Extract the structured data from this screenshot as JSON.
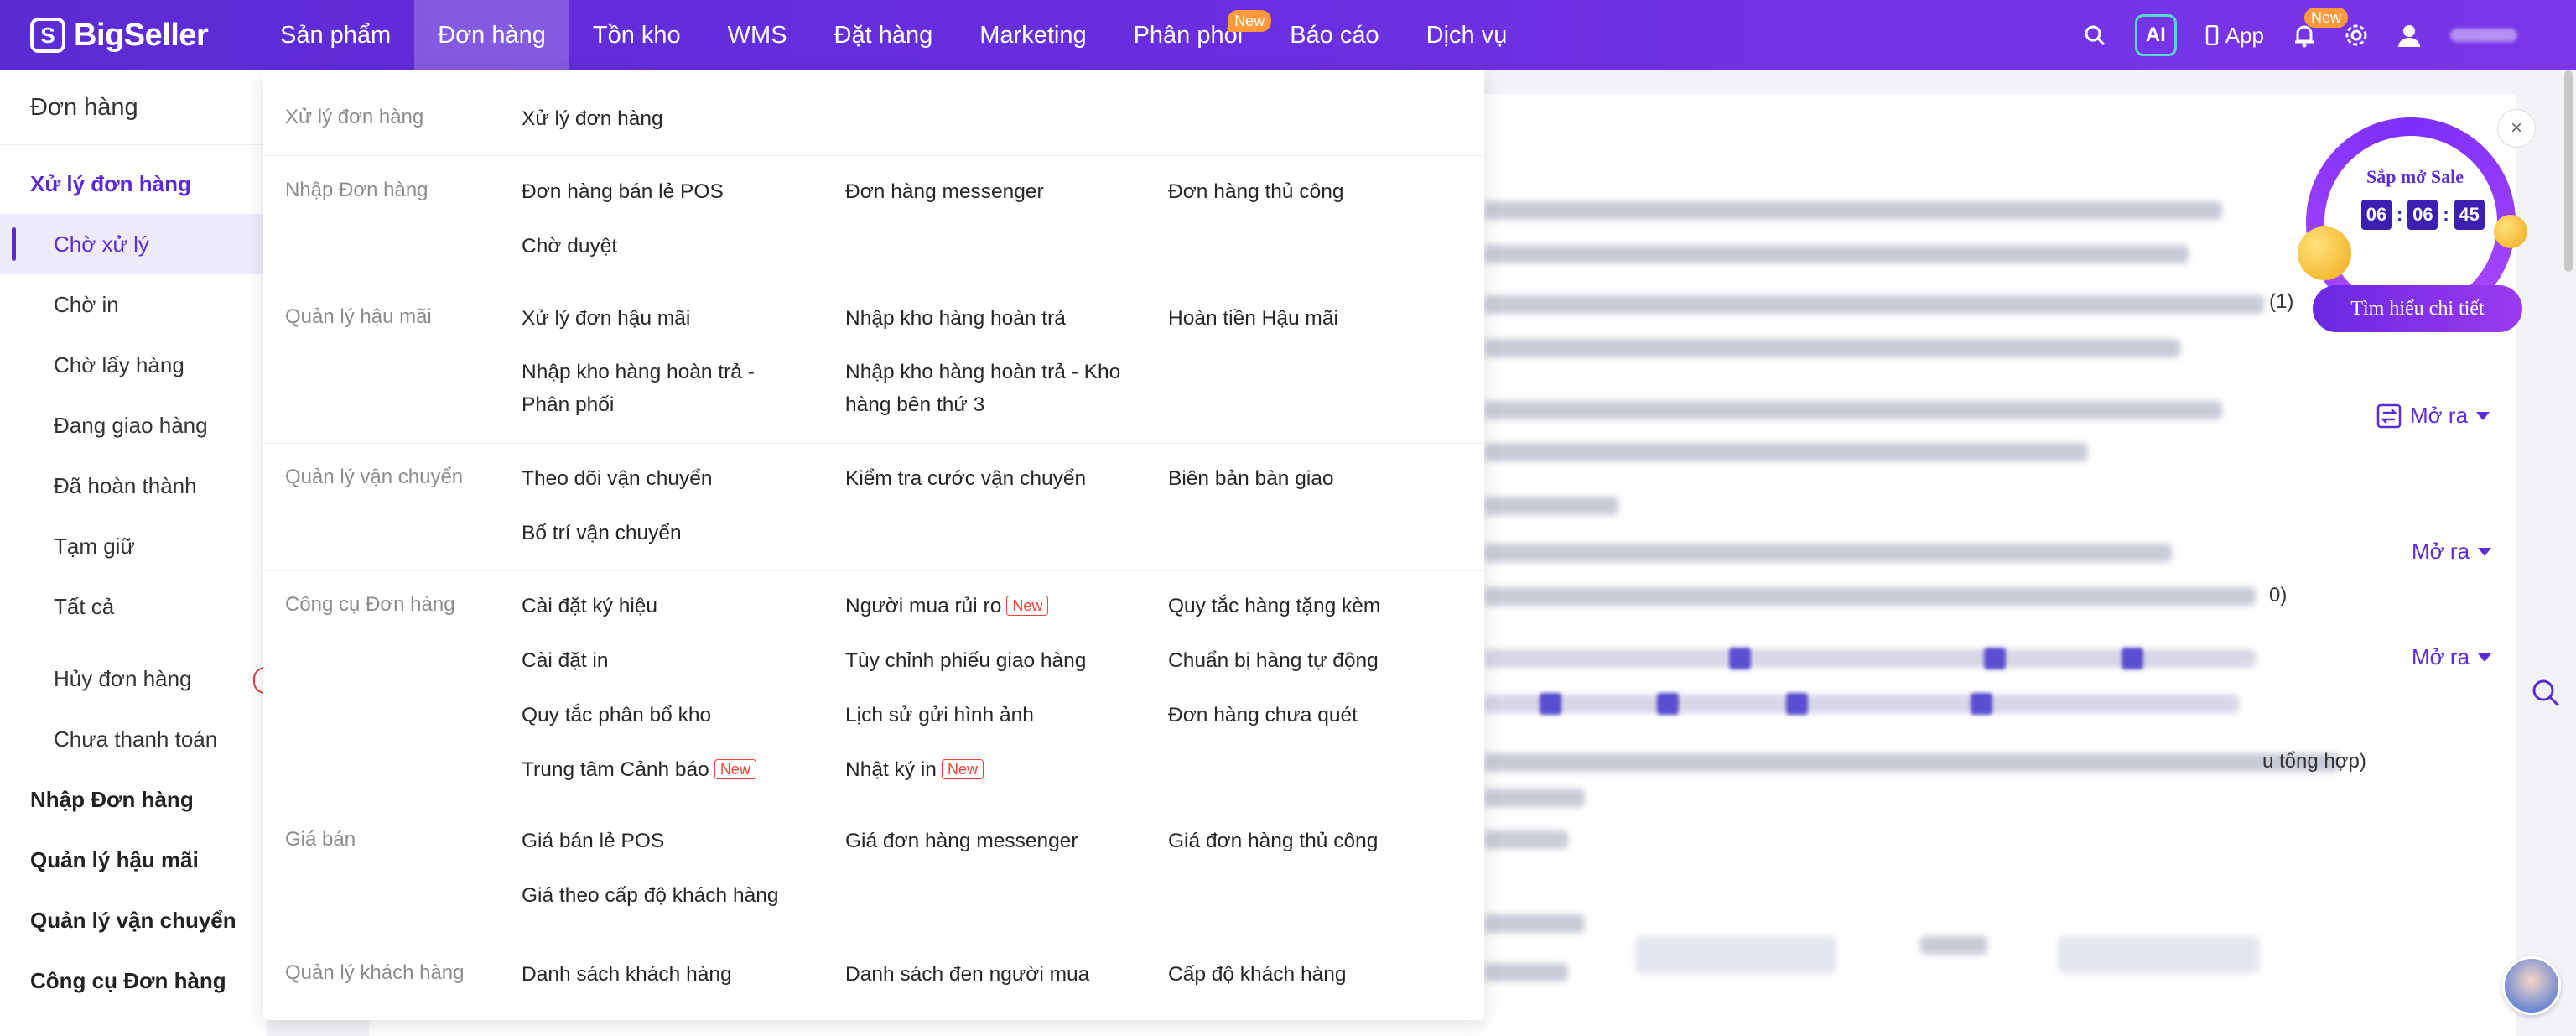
{
  "brand": {
    "name": "BigSeller",
    "accent": "#5b2bd3",
    "nav_gradient": [
      "#5b2bd3",
      "#7a36e8"
    ]
  },
  "nav": {
    "items": [
      {
        "label": "Sản phẩm"
      },
      {
        "label": "Đơn hàng",
        "active": true
      },
      {
        "label": "Tồn kho"
      },
      {
        "label": "WMS"
      },
      {
        "label": "Đặt hàng"
      },
      {
        "label": "Marketing"
      },
      {
        "label": "Phân phối",
        "badge": "New"
      },
      {
        "label": "Báo cáo"
      },
      {
        "label": "Dịch vụ"
      }
    ],
    "ai_label": "AI",
    "app_label": "App",
    "bell_badge": "New"
  },
  "sidebar": {
    "title": "Đơn hàng",
    "primary_group": "Xử lý đơn hàng",
    "items": [
      "Chờ xử lý",
      "Chờ in",
      "Chờ lấy hàng",
      "Đang giao hàng",
      "Đã hoàn thành",
      "Tạm giữ",
      "Tất cả"
    ],
    "items2": [
      "Hủy đơn hàng",
      "Chưa thanh toán"
    ],
    "groups": [
      "Nhập Đơn hàng",
      "Quản lý hậu mãi",
      "Quản lý vận chuyển",
      "Công cụ Đơn hàng"
    ]
  },
  "mega": {
    "new_tag": "New",
    "sections": {
      "xu_ly": {
        "category": "Xử lý đơn hàng",
        "links": [
          "Xử lý đơn hàng"
        ]
      },
      "nhap": {
        "category": "Nhập Đơn hàng",
        "links": [
          "Đơn hàng bán lẻ POS",
          "Đơn hàng messenger",
          "Đơn hàng thủ công",
          "Chờ duyệt"
        ]
      },
      "hau_mai": {
        "category": "Quản lý hậu mãi",
        "links": [
          "Xử lý đơn hậu mãi",
          "Nhập kho hàng hoàn trả",
          "Hoàn tiền Hậu mãi",
          "Nhập kho hàng hoàn trả - Phân phối",
          "Nhập kho hàng hoàn trả - Kho hàng bên thứ 3"
        ]
      },
      "van_chuyen": {
        "category": "Quản lý vận chuyển",
        "links": [
          "Theo dõi vận chuyển",
          "Kiểm tra cước vận chuyển",
          "Biên bản bàn giao",
          "Bố trí vận chuyển"
        ]
      },
      "cong_cu": {
        "category": "Công cụ Đơn hàng",
        "links": [
          "Cài đặt ký hiệu",
          "Người mua rủi ro",
          "Quy tắc hàng tặng kèm",
          "Cài đặt in",
          "Tùy chỉnh phiếu giao hàng",
          "Chuẩn bị hàng tự động",
          "Quy tắc phân bổ kho",
          "Lịch sử gửi hình ảnh",
          "Đơn hàng chưa quét",
          "Trung tâm Cảnh báo",
          "Nhật ký in"
        ]
      },
      "gia_ban": {
        "category": "Giá bán",
        "links": [
          "Giá bán lẻ POS",
          "Giá đơn hàng messenger",
          "Giá đơn hàng thủ công",
          "Giá theo cấp độ khách hàng"
        ]
      },
      "khach_hang": {
        "category": "Quản lý khách hàng",
        "links": [
          "Danh sách khách hàng",
          "Danh sách đen người mua",
          "Cấp độ khách hàng"
        ]
      }
    }
  },
  "background": {
    "open_label": "Mở ra",
    "fragments": [
      "(1)",
      "0)",
      "u tổng hợp)"
    ]
  },
  "promo": {
    "title": "Sắp mở Sale",
    "timer": [
      "06",
      "06",
      "45"
    ],
    "button": "Tìm hiểu chi tiết",
    "close": "×"
  }
}
